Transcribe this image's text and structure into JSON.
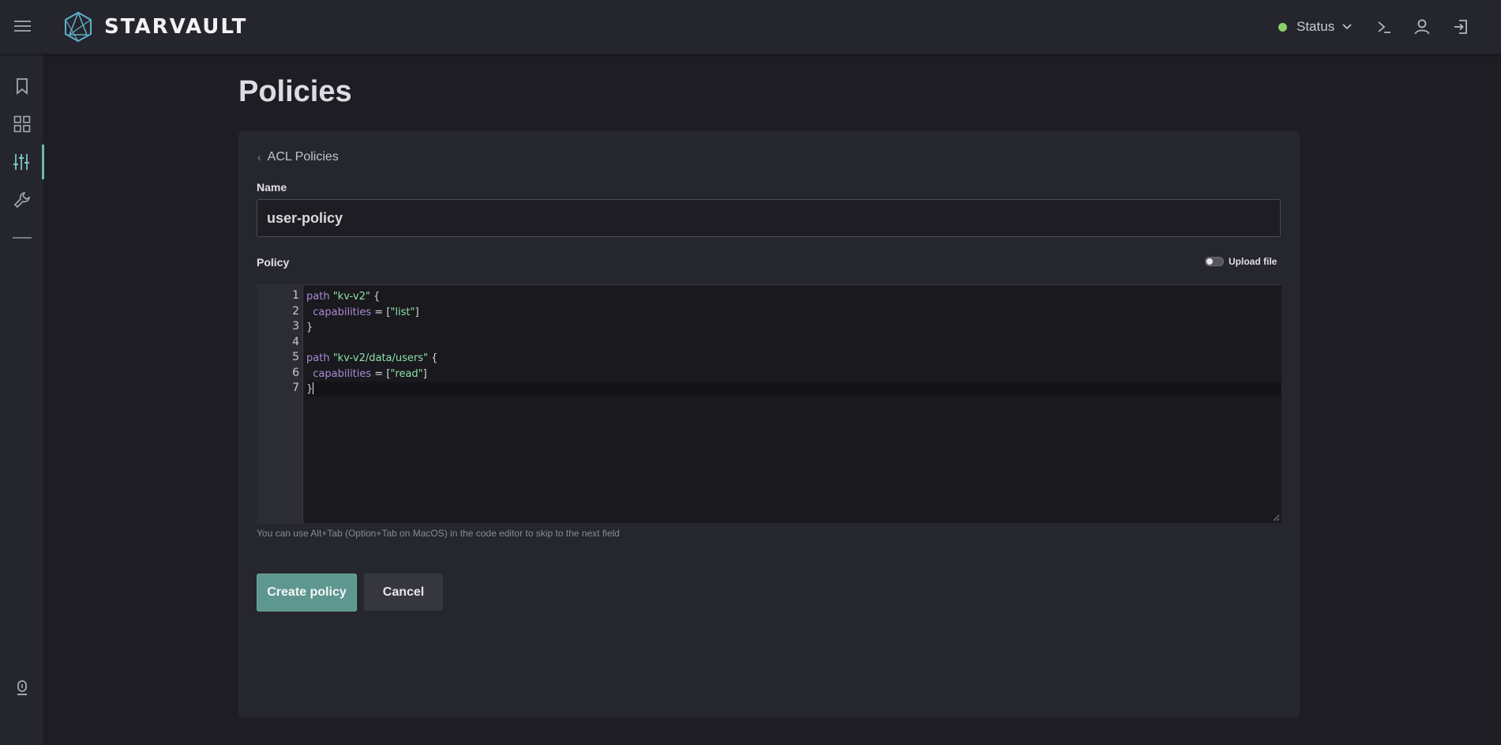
{
  "topbar": {
    "brand": "STARVAULT",
    "status_label": "Status",
    "status_color": "#8ccf6e",
    "icons": [
      "menu-icon",
      "terminal-icon",
      "user-icon",
      "logout-icon"
    ]
  },
  "sidebar": {
    "items": [
      {
        "name": "bookmark",
        "icon": "bookmark-icon"
      },
      {
        "name": "dashboard",
        "icon": "grid-icon"
      },
      {
        "name": "policies",
        "icon": "sliders-icon",
        "active": true
      },
      {
        "name": "tools",
        "icon": "wrench-icon"
      }
    ],
    "bottom_icon": "lightbulb-icon"
  },
  "page": {
    "title": "Policies",
    "back_link": "ACL Policies",
    "name_label": "Name",
    "name_value": "user-policy",
    "policy_label": "Policy",
    "upload_label": "Upload file",
    "upload_enabled": false,
    "hint": "You can use Alt+Tab (Option+Tab on MacOS) in the code editor to skip to the next field",
    "create_button": "Create policy",
    "cancel_button": "Cancel"
  },
  "editor": {
    "line_numbers": [
      "1",
      "2",
      "3",
      "4",
      "5",
      "6",
      "7"
    ],
    "lines": [
      [
        {
          "t": "path",
          "c": "kw"
        },
        {
          "t": " "
        },
        {
          "t": "\"kv-v2\"",
          "c": "str"
        },
        {
          "t": " {"
        }
      ],
      [
        {
          "t": "  "
        },
        {
          "t": "capabilities",
          "c": "kw"
        },
        {
          "t": " = ["
        },
        {
          "t": "\"list\"",
          "c": "str"
        },
        {
          "t": "]"
        }
      ],
      [
        {
          "t": "}"
        }
      ],
      [],
      [
        {
          "t": "path",
          "c": "kw"
        },
        {
          "t": " "
        },
        {
          "t": "\"kv-v2/data/users\"",
          "c": "str"
        },
        {
          "t": " {"
        }
      ],
      [
        {
          "t": "  "
        },
        {
          "t": "capabilities",
          "c": "kw"
        },
        {
          "t": " = ["
        },
        {
          "t": "\"read\"",
          "c": "str"
        },
        {
          "t": "]"
        }
      ],
      [
        {
          "t": "}"
        }
      ]
    ],
    "current_line": 7,
    "accent": "#6ab8b0"
  }
}
